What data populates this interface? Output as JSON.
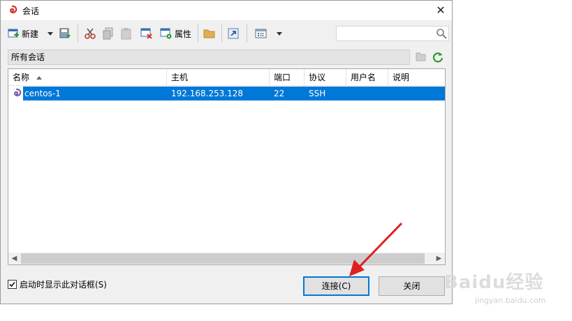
{
  "window": {
    "title": "会话",
    "close_glyph": "✕"
  },
  "toolbar": {
    "new_label": "新建",
    "properties_label": "属性",
    "search": {
      "value": "",
      "placeholder": ""
    },
    "icons": [
      "new-session-icon",
      "dropdown-arrow-icon",
      "save-icon",
      "cut-icon",
      "copy-icon",
      "paste-icon",
      "delete-icon",
      "properties-icon",
      "folder-icon",
      "shortcut-icon",
      "view-icon",
      "search-icon"
    ]
  },
  "path": {
    "label": "所有会话"
  },
  "list": {
    "columns": [
      "名称",
      "主机",
      "端口",
      "协议",
      "用户名",
      "说明"
    ],
    "rows": [
      {
        "name": "centos-1",
        "host": "192.168.253.128",
        "port": "22",
        "protocol": "SSH",
        "user": "",
        "desc": ""
      }
    ]
  },
  "footer": {
    "startup_label": "启动时显示此对话框(S)",
    "startup_checked": true,
    "connect_label": "连接(C)",
    "close_label": "关闭"
  },
  "watermark": {
    "main": "Baidu经验",
    "sub": "jingyan.baidu.com"
  },
  "colors": {
    "selection": "#0078d7",
    "annotation_arrow": "#e02020",
    "accent": "#0078d7"
  }
}
